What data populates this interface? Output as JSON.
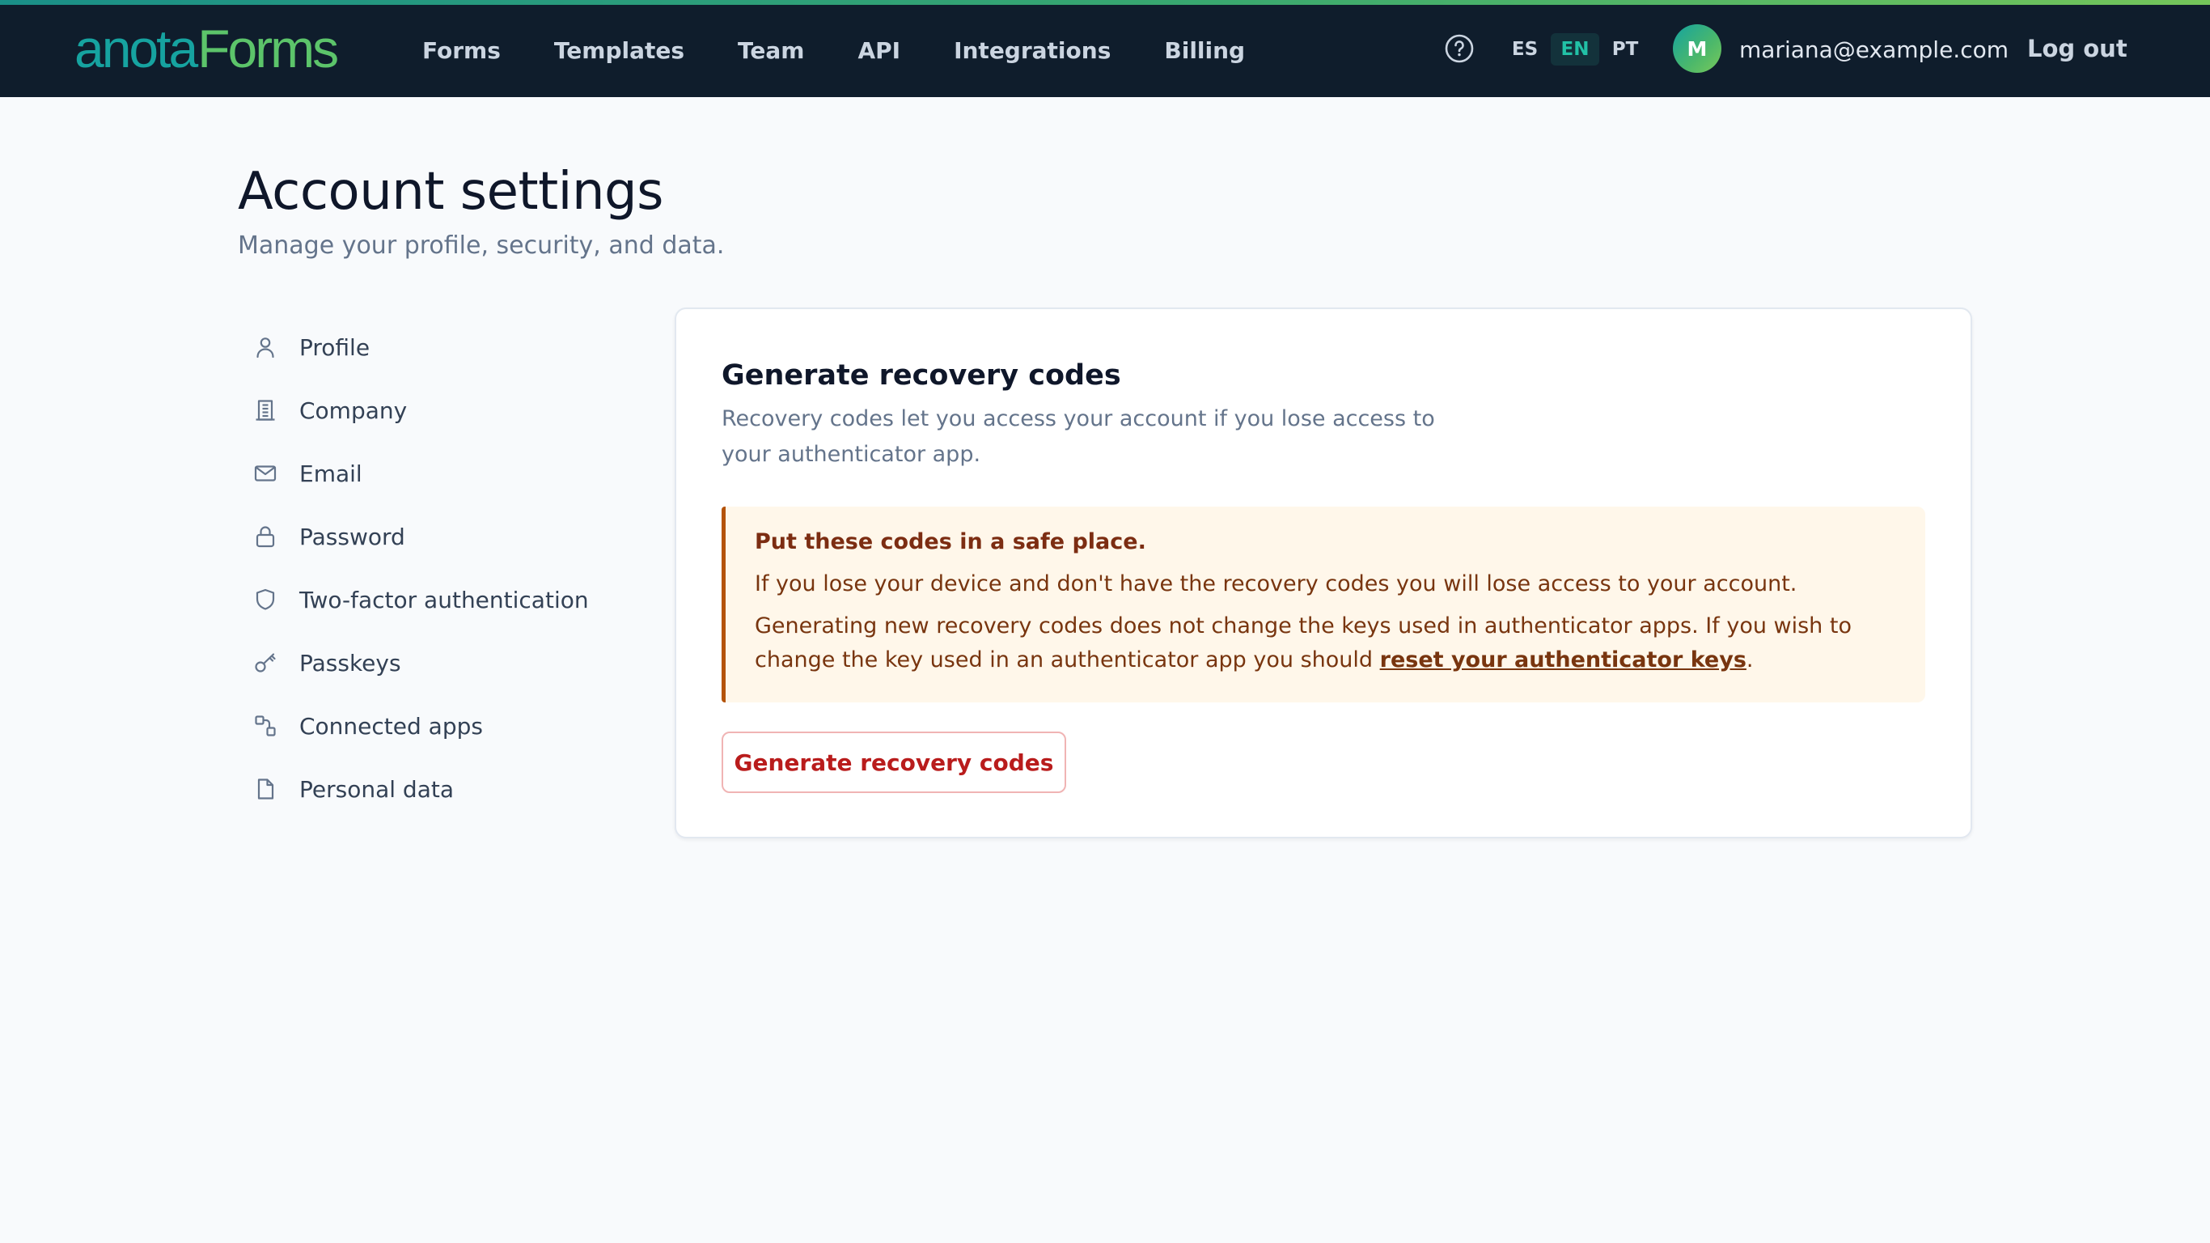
{
  "brand": {
    "part1": "anota",
    "part2": "Forms"
  },
  "nav": {
    "items": [
      "Forms",
      "Templates",
      "Team",
      "API",
      "Integrations",
      "Billing"
    ]
  },
  "header": {
    "help_icon": "question-circle-icon",
    "languages": [
      "ES",
      "EN",
      "PT"
    ],
    "active_language": "EN",
    "avatar_initial": "M",
    "user_email": "mariana@example.com",
    "logout_label": "Log out"
  },
  "page": {
    "title": "Account settings",
    "subtitle": "Manage your profile, security, and data."
  },
  "sidebar": {
    "items": [
      {
        "label": "Profile",
        "icon": "user-icon"
      },
      {
        "label": "Company",
        "icon": "building-icon"
      },
      {
        "label": "Email",
        "icon": "mail-icon"
      },
      {
        "label": "Password",
        "icon": "lock-icon"
      },
      {
        "label": "Two-factor authentication",
        "icon": "shield-icon"
      },
      {
        "label": "Passkeys",
        "icon": "key-icon"
      },
      {
        "label": "Connected apps",
        "icon": "link-icon"
      },
      {
        "label": "Personal data",
        "icon": "document-icon"
      }
    ]
  },
  "card": {
    "title": "Generate recovery codes",
    "description": "Recovery codes let you access your account if you lose access to your authenticator app.",
    "alert": {
      "title": "Put these codes in a safe place.",
      "line1": "If you lose your device and don't have the recovery codes you will lose access to your account.",
      "line2_prefix": "Generating new recovery codes does not change the keys used in authenticator apps. If you wish to change the key used in an authenticator app you should ",
      "link_text": "reset your authenticator keys",
      "line2_suffix": "."
    },
    "button_label": "Generate recovery codes"
  },
  "colors": {
    "topbar": "#0f1d2c",
    "brand_teal": "#16a3a0",
    "brand_green": "#5cc46a",
    "active_language": "#22c1a6",
    "danger": "#b91c1c",
    "alert_bg": "#fff7ea",
    "alert_border": "#b45309"
  }
}
